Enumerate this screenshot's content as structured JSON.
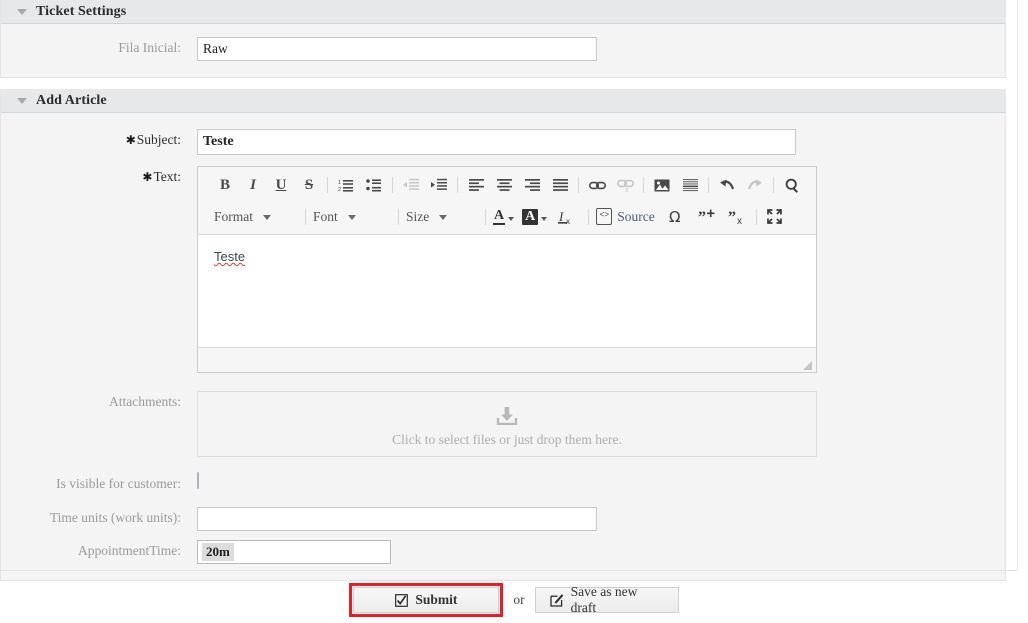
{
  "ticket_settings": {
    "title": "Ticket Settings",
    "collapse_icon": "triangle-down-icon",
    "fields": [
      {
        "label": "Fila Inicial:",
        "value": "Raw",
        "required": false
      }
    ]
  },
  "add_article": {
    "title": "Add Article",
    "collapse_icon": "triangle-down-icon",
    "subject": {
      "label": "Subject:",
      "required": true,
      "required_marker": "✱",
      "value": "Teste"
    },
    "text": {
      "label": "Text:",
      "required": true,
      "required_marker": "✱",
      "body": "Teste",
      "spellcheck_underline": true
    },
    "editor": {
      "toolbar_row1": [
        {
          "name": "bold-icon",
          "glyph": "B",
          "enabled": true
        },
        {
          "name": "italic-icon",
          "glyph": "I",
          "enabled": true
        },
        {
          "name": "underline-icon",
          "glyph": "U",
          "enabled": true
        },
        {
          "name": "strikethrough-icon",
          "glyph": "S",
          "enabled": true
        },
        {
          "name": "separator",
          "glyph": "",
          "enabled": true
        },
        {
          "name": "numbered-list-icon",
          "glyph": "",
          "enabled": true
        },
        {
          "name": "bulleted-list-icon",
          "glyph": "",
          "enabled": true
        },
        {
          "name": "separator",
          "glyph": "",
          "enabled": true
        },
        {
          "name": "decrease-indent-icon",
          "glyph": "",
          "enabled": false
        },
        {
          "name": "increase-indent-icon",
          "glyph": "",
          "enabled": true
        },
        {
          "name": "separator",
          "glyph": "",
          "enabled": true
        },
        {
          "name": "align-left-icon",
          "glyph": "",
          "enabled": true
        },
        {
          "name": "align-center-icon",
          "glyph": "",
          "enabled": true
        },
        {
          "name": "align-right-icon",
          "glyph": "",
          "enabled": true
        },
        {
          "name": "align-justify-icon",
          "glyph": "",
          "enabled": true
        },
        {
          "name": "separator",
          "glyph": "",
          "enabled": true
        },
        {
          "name": "link-icon",
          "glyph": "",
          "enabled": true
        },
        {
          "name": "unlink-icon",
          "glyph": "",
          "enabled": false
        },
        {
          "name": "separator",
          "glyph": "",
          "enabled": true
        },
        {
          "name": "image-icon",
          "glyph": "",
          "enabled": true
        },
        {
          "name": "horizontal-rule-icon",
          "glyph": "",
          "enabled": true
        },
        {
          "name": "separator",
          "glyph": "",
          "enabled": true
        },
        {
          "name": "undo-icon",
          "glyph": "",
          "enabled": true
        },
        {
          "name": "redo-icon",
          "glyph": "",
          "enabled": false
        },
        {
          "name": "separator",
          "glyph": "",
          "enabled": true
        },
        {
          "name": "find-icon",
          "glyph": "",
          "enabled": true
        }
      ],
      "format_label": "Format",
      "font_label": "Font",
      "size_label": "Size",
      "text_color_label": "A",
      "bg_color_label": "A",
      "remove_format_label": "I",
      "source_label": "Source",
      "special_char_label": "Ω",
      "quote_add_label": "❞",
      "quote_remove_label": "❞",
      "maximize_icon": "maximize-icon",
      "resize_grip_icon": "resize-grip-icon"
    },
    "attachments": {
      "label": "Attachments:",
      "dropzone_icon": "download-tray-icon",
      "dropzone_text": "Click to select files or just drop them here."
    },
    "visible_for_customer": {
      "label": "Is visible for customer:",
      "checked": false
    },
    "time_units": {
      "label": "Time units (work units):",
      "value": "",
      "placeholder": ""
    },
    "appointment_time": {
      "label": "AppointmentTime:",
      "chip_value": "20m"
    }
  },
  "footer": {
    "submit_label": "Submit",
    "submit_icon": "checked-box-icon",
    "submit_highlight_color": "#ef1b24",
    "or_label": "or",
    "save_draft_label": "Save as new draft",
    "save_draft_icon": "edit-pencil-square-icon"
  }
}
